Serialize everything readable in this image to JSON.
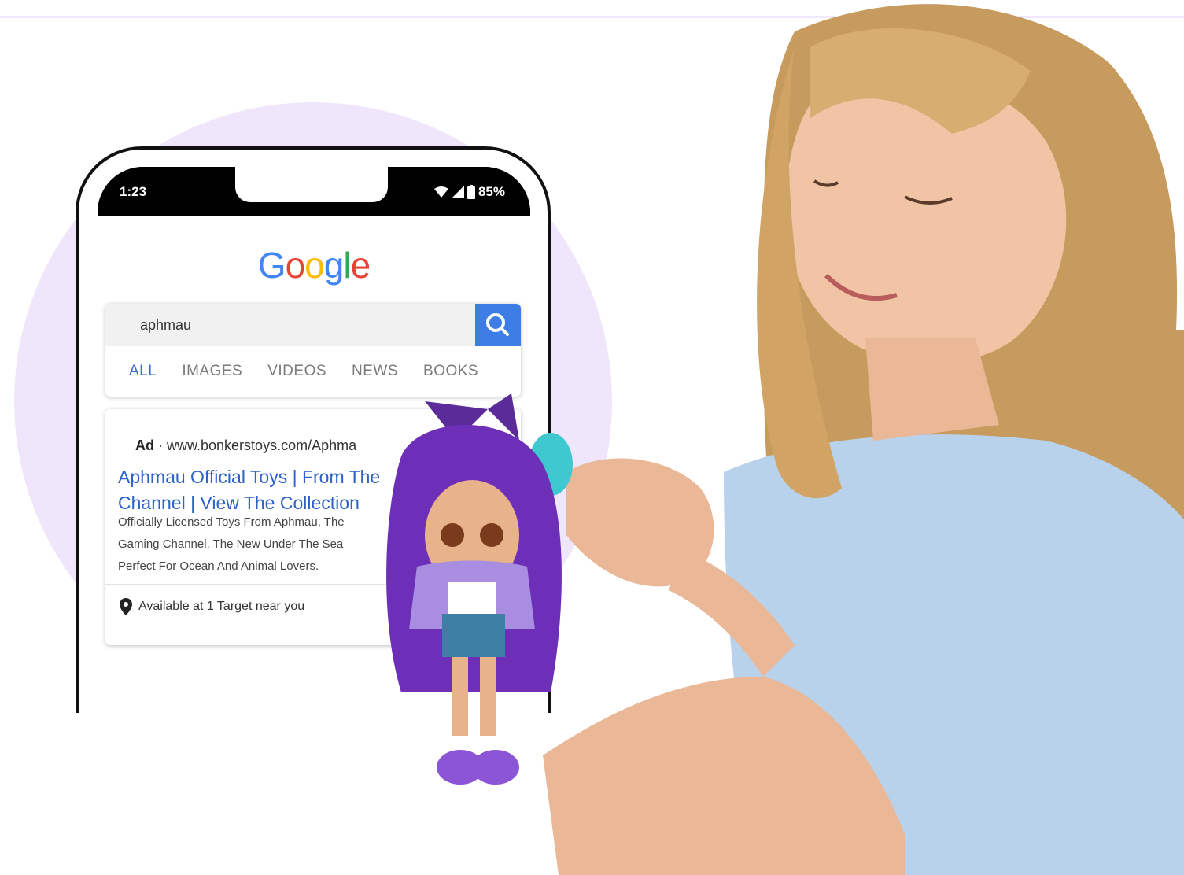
{
  "phone": {
    "status_time": "1:23",
    "battery": "85%",
    "search_query": "aphmau",
    "tabs": [
      "ALL",
      "IMAGES",
      "VIDEOS",
      "NEWS",
      "BOOKS"
    ],
    "ad": {
      "label": "Ad",
      "url": "· www.bonkerstoys.com/Aphma",
      "title_line1": "Aphmau Official Toys | From The",
      "title_line2": "Channel | View The Collection",
      "desc_line1": "Officially Licensed Toys From Aphmau, The",
      "desc_line2": "Gaming Channel. The New Under The Sea",
      "desc_line3": "Perfect For Ocean And Animal Lovers.",
      "location": "Available at 1 Target near you"
    }
  },
  "colors": {
    "accent_purple": "#efe6fb",
    "google_blue": "#4285f4",
    "google_red": "#ea4335",
    "google_yellow": "#fbbc05",
    "google_green": "#34a853",
    "link_blue": "#2d62c8"
  },
  "icons": [
    "wifi-icon",
    "signal-icon",
    "battery-icon",
    "search-icon",
    "map-pin-icon"
  ]
}
